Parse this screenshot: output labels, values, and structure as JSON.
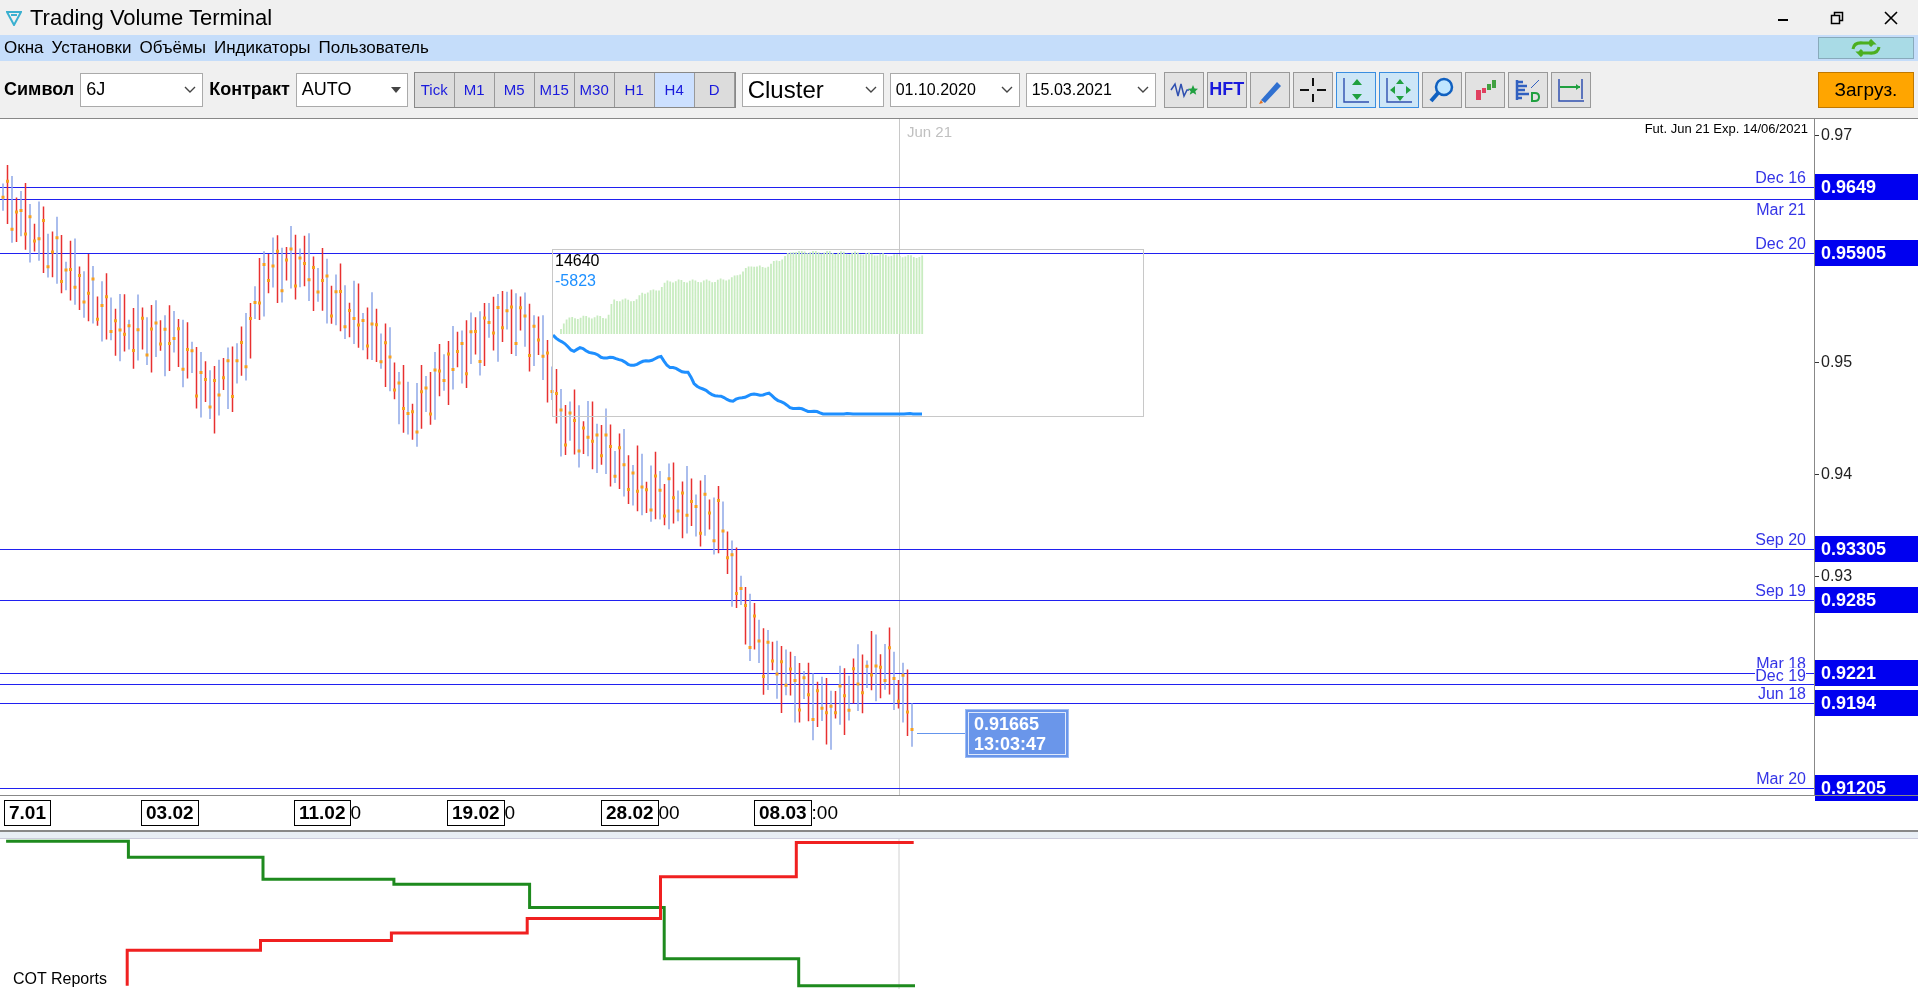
{
  "window": {
    "title": "Trading Volume Terminal"
  },
  "menu": [
    {
      "label": "Окна"
    },
    {
      "label": "Установки"
    },
    {
      "label": "Объёмы"
    },
    {
      "label": "Индикаторы"
    },
    {
      "label": "Пользователь"
    }
  ],
  "toolbar": {
    "symbol_label": "Символ",
    "symbol": "6J",
    "contract_label": "Контракт",
    "contract": "AUTO",
    "timeframes": [
      {
        "label": "Tick",
        "selected": false
      },
      {
        "label": "M1",
        "selected": false
      },
      {
        "label": "M5",
        "selected": false
      },
      {
        "label": "M15",
        "selected": false
      },
      {
        "label": "M30",
        "selected": false
      },
      {
        "label": "H1",
        "selected": false
      },
      {
        "label": "H4",
        "selected": true
      },
      {
        "label": "D",
        "selected": false
      }
    ],
    "chart_type": "Cluster",
    "date_from": "01.10.2020",
    "date_to": "15.03.2021",
    "tools": [
      {
        "kind": "wave",
        "selected": false
      },
      {
        "kind": "text",
        "label": "HFT",
        "selected": false
      },
      {
        "kind": "pen",
        "selected": false
      },
      {
        "kind": "cross",
        "selected": false
      },
      {
        "kind": "vscale",
        "selected": true
      },
      {
        "kind": "move",
        "selected": true
      },
      {
        "kind": "zoom",
        "selected": false
      },
      {
        "kind": "bars",
        "selected": false
      },
      {
        "kind": "profile",
        "selected": false
      },
      {
        "kind": "range",
        "selected": false
      }
    ],
    "load_button": "Загруз."
  },
  "chart": {
    "expiry_note": "Fut. Jun 21 Exp. 14/06/2021",
    "cursor_label": "Jun 21",
    "axis_ticks": [
      "0.97",
      "0.95",
      "0.94",
      "0.93"
    ],
    "levels": [
      {
        "label": "Dec 16",
        "tag": "0.9649"
      },
      {
        "label": "Mar 21"
      },
      {
        "label": "Dec 20",
        "tag": "0.95905"
      },
      {
        "label": "Sep 20",
        "tag": "0.93305"
      },
      {
        "label": "Sep 19",
        "tag": "0.9285"
      },
      {
        "label": "Mar 18",
        "tag": "0.9221"
      },
      {
        "label": "Dec 19"
      },
      {
        "label": "Jun 18",
        "tag": "0.9194"
      },
      {
        "label": "Mar 20",
        "tag": "0.91205"
      }
    ],
    "inset": {
      "volume": "14640",
      "delta": "-5823"
    },
    "price_tooltip": {
      "price": "0.91665",
      "time": "13:03:47"
    },
    "dates": [
      {
        "label": "7.01"
      },
      {
        "label": "03.02"
      },
      {
        "label": "11.02",
        "tail": "0"
      },
      {
        "label": "19.02",
        "tail": "0"
      },
      {
        "label": "28.02",
        "tail": "00"
      },
      {
        "label": "08.03",
        "tail": ":00"
      }
    ]
  },
  "cot_panel": {
    "title": "COT Reports"
  }
}
